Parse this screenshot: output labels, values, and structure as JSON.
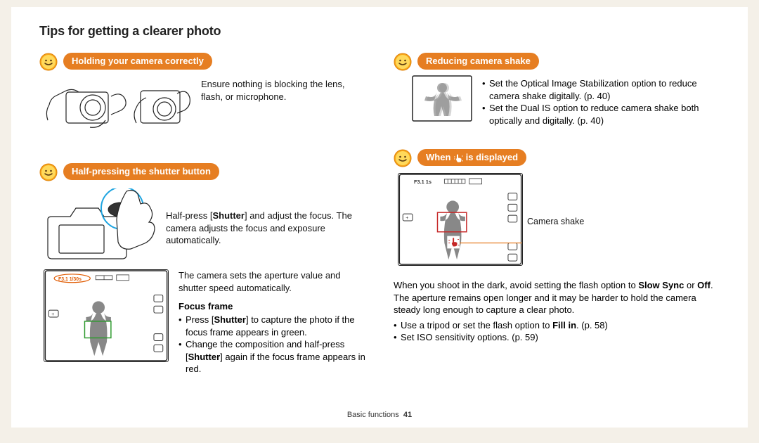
{
  "title": "Tips for getting a clearer photo",
  "section1": {
    "heading": "Holding your camera correctly",
    "text": "Ensure nothing is blocking the lens, flash, or microphone."
  },
  "section2": {
    "heading": "Half-pressing the shutter button",
    "para1a": "Half-press [",
    "para1b": "Shutter",
    "para1c": "] and adjust the focus. The camera adjusts the focus and exposure automatically.",
    "para2": "The camera sets the aperture value and shutter speed automatically.",
    "focusFrameLabel": "Focus frame",
    "bullet1a": "Press [",
    "bullet1b": "Shutter",
    "bullet1c": "] to capture the photo if the focus frame appears in green.",
    "bullet2a": "Change the composition and half-press [",
    "bullet2b": "Shutter",
    "bullet2c": "] again if the focus frame appears in red."
  },
  "section3": {
    "heading": "Reducing camera shake",
    "bullet1": "Set the Optical Image Stabilization option to reduce camera shake digitally. (p. 40)",
    "bullet2": "Set the Dual IS option to reduce camera shake both optically and digitally. (p. 40)"
  },
  "section4": {
    "headingPrefix": "When ",
    "headingSuffix": " is displayed",
    "callout": "Camera shake",
    "para1a": "When you shoot in the dark, avoid setting the flash option to ",
    "para1b": "Slow Sync",
    "para1c": " or ",
    "para1d": "Off",
    "para1e": ". The aperture remains open longer and it may be harder to hold the camera steady long enough to capture a clear photo.",
    "bullet1a": "Use a tripod or set the flash option to ",
    "bullet1b": "Fill in",
    "bullet1c": ". (p. 58)",
    "bullet2": "Set ISO sensitivity options. (p. 59)"
  },
  "footer": {
    "section": "Basic functions",
    "page": "41"
  },
  "screen": {
    "topText": "F3.1 1/30s",
    "topText2": "F3.1 1s"
  }
}
